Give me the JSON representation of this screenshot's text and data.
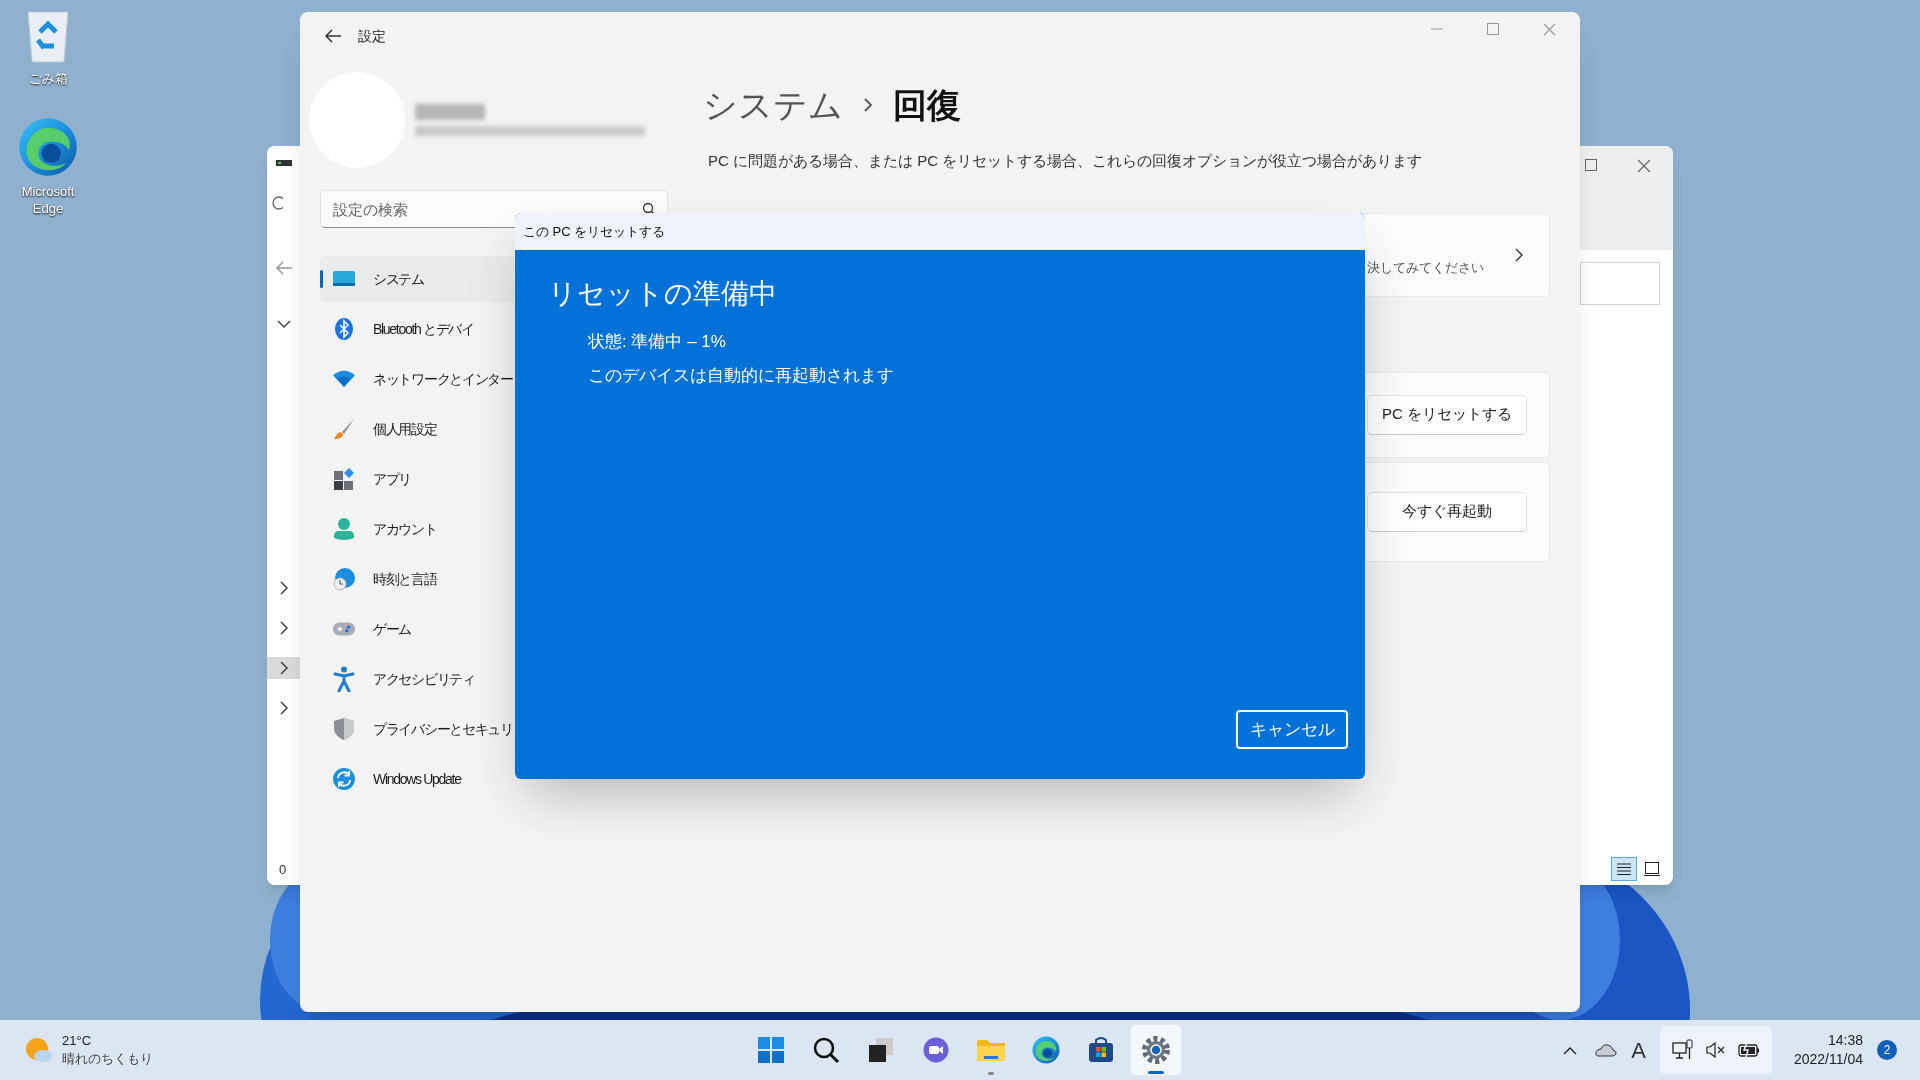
{
  "desktop_icons": [
    {
      "kind": "recycle",
      "label": "ごみ箱"
    },
    {
      "kind": "edge",
      "label": "Microsoft Edge"
    }
  ],
  "background_window": {
    "tree_rows": [
      {
        "expanded": true,
        "selected": false
      },
      {
        "expanded": false,
        "selected": false
      },
      {
        "expanded": false,
        "selected": false
      },
      {
        "expanded": false,
        "selected": true
      },
      {
        "expanded": false,
        "selected": false
      }
    ],
    "status_text": "0",
    "views": [
      {
        "kind": "details",
        "selected": true
      },
      {
        "kind": "tiles",
        "selected": false
      }
    ]
  },
  "settings": {
    "title": "設定",
    "search": {
      "placeholder": "設定の検索"
    },
    "nav": [
      {
        "kind": "system",
        "label": "システム",
        "selected": true
      },
      {
        "kind": "bluetooth",
        "label": "Bluetooth とデバイ",
        "selected": false
      },
      {
        "kind": "network",
        "label": "ネットワークとインター",
        "selected": false
      },
      {
        "kind": "personalization",
        "label": "個人用設定",
        "selected": false
      },
      {
        "kind": "apps",
        "label": "アプリ",
        "selected": false
      },
      {
        "kind": "accounts",
        "label": "アカウント",
        "selected": false
      },
      {
        "kind": "time",
        "label": "時刻と言語",
        "selected": false
      },
      {
        "kind": "gaming",
        "label": "ゲーム",
        "selected": false
      },
      {
        "kind": "accessibility",
        "label": "アクセシビリティ",
        "selected": false
      },
      {
        "kind": "privacy",
        "label": "プライバシーとセキュリ",
        "selected": false
      },
      {
        "kind": "update",
        "label": "Windows Update",
        "selected": false
      }
    ],
    "breadcrumb": [
      "システム",
      "回復"
    ],
    "description": "PC に問題がある場合、または PC をリセットする場合、これらの回復オプションが役立つ場合があります",
    "cards": [
      {
        "kind": "link",
        "text": "決してみてください"
      },
      {
        "kind": "button",
        "button": "PC をリセットする"
      },
      {
        "kind": "button",
        "button": "今すぐ再起動"
      }
    ]
  },
  "dialog": {
    "title": "この PC をリセットする",
    "heading": "リセットの準備中",
    "lines": [
      "状態: 準備中 – 1%",
      "このデバイスは自動的に再起動されます"
    ],
    "button": "キャンセル"
  },
  "taskbar": {
    "weather": {
      "temperature": "21°C",
      "condition": "晴れのちくもり"
    },
    "apps": [
      {
        "kind": "start",
        "running": false,
        "selected": false
      },
      {
        "kind": "search",
        "running": false,
        "selected": false
      },
      {
        "kind": "taskview",
        "running": false,
        "selected": false
      },
      {
        "kind": "chat",
        "running": false,
        "selected": false
      },
      {
        "kind": "explorer",
        "running": true,
        "selected": false
      },
      {
        "kind": "edge",
        "running": false,
        "selected": false
      },
      {
        "kind": "store",
        "running": false,
        "selected": false
      },
      {
        "kind": "settings",
        "running": true,
        "selected": true
      }
    ],
    "ime": "A",
    "time": "14:38",
    "date": "2022/11/04",
    "notifications": "2"
  }
}
